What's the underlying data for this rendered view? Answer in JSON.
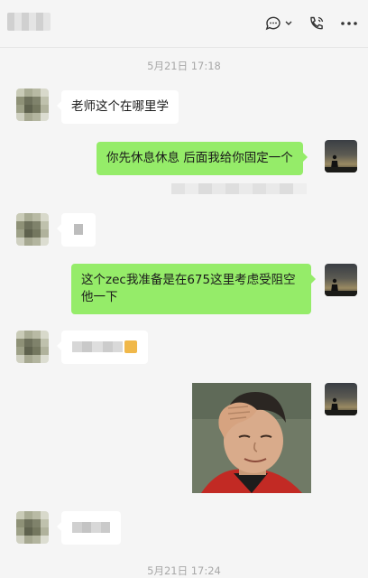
{
  "header": {
    "chat_icon": "chat-bubble-icon",
    "call_icon": "phone-call-icon",
    "more_icon": "more-dots-icon"
  },
  "timestamps": {
    "first": "5月21日 17:18",
    "second": "5月21日 17:24"
  },
  "messages": {
    "m1": "老师这个在哪里学",
    "m2": "你先休息休息 后面我给你固定一个",
    "m4_line1": "这个zec我准备是在675这里考虑受阻空",
    "m4_line2": "他一下"
  },
  "colors": {
    "background": "#f5f5f5",
    "incoming_bubble": "#ffffff",
    "outgoing_bubble": "#95ec69",
    "timestamp_text": "#a8a8a8"
  }
}
